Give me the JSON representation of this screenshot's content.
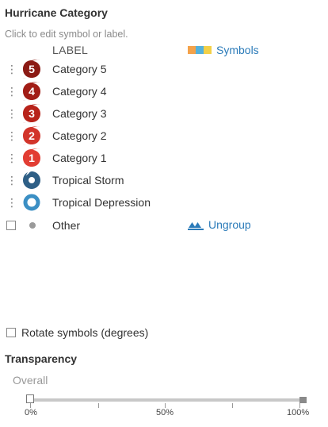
{
  "title": "Hurricane Category",
  "hint": "Click to edit symbol or label.",
  "column_label": "LABEL",
  "symbols_link": {
    "label": "Symbols",
    "swatch_colors": [
      "#f4a24a",
      "#54b1dc",
      "#f2d048"
    ]
  },
  "categories": [
    {
      "number": "5",
      "label": "Category 5",
      "icon": "hurricane-icon",
      "color": "#8b1a14"
    },
    {
      "number": "4",
      "label": "Category 4",
      "icon": "hurricane-icon",
      "color": "#a21d16"
    },
    {
      "number": "3",
      "label": "Category 3",
      "icon": "hurricane-icon",
      "color": "#b8231a"
    },
    {
      "number": "2",
      "label": "Category 2",
      "icon": "hurricane-icon",
      "color": "#d2342a"
    },
    {
      "number": "1",
      "label": "Category 1",
      "icon": "hurricane-icon",
      "color": "#e23d33"
    },
    {
      "number": "",
      "label": "Tropical Storm",
      "icon": "tropical-storm-icon",
      "color": "#2e5f86"
    },
    {
      "number": "",
      "label": "Tropical Depression",
      "icon": "tropical-depression-icon",
      "color": "#3b8fc4"
    }
  ],
  "other": {
    "label": "Other",
    "icon": "dot-icon",
    "color": "#9a9a9a"
  },
  "ungroup": {
    "label": "Ungroup",
    "color": "#2b7bb9"
  },
  "rotate_label": "Rotate symbols (degrees)",
  "transparency": {
    "title": "Transparency",
    "overall_label": "Overall",
    "value": 0,
    "ticks": [
      "0%",
      "50%",
      "100%"
    ]
  }
}
